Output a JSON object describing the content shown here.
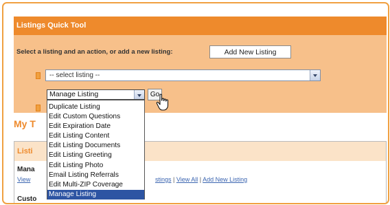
{
  "quick_tool": {
    "title": "Listings Quick Tool",
    "prompt": "Select a listing and an action, or add a new listing:",
    "add_button_label": "Add New Listing",
    "listing_select_value": "-- select listing --",
    "action_select_value": "Manage Listing",
    "go_button_label": "Go",
    "action_options": [
      "Duplicate Listing",
      "Edit Custom Questions",
      "Edit Expiration Date",
      "Edit Listing Content",
      "Edit Listing Documents",
      "Edit Listing Greeting",
      "Edit Listing Photo",
      "Email Listing Referrals",
      "Edit Multi-ZIP Coverage",
      "Manage Listing"
    ],
    "highlighted_option": "Manage Listing"
  },
  "section": {
    "title_visible": "My T",
    "panel_header_visible": "Listi",
    "manage_heading_visible": "Mana",
    "view_link_visible": "View",
    "links": {
      "listings_partial": "stings",
      "separator": "|",
      "view_all": "View All",
      "add_new_listing": "Add New Listing"
    },
    "custom_heading_visible": "Custo"
  },
  "colors": {
    "accent_orange": "#ee8a2c",
    "panel_peach": "#f7c08a",
    "selection_blue": "#2d54a3",
    "link_blue": "#3a64b0"
  }
}
